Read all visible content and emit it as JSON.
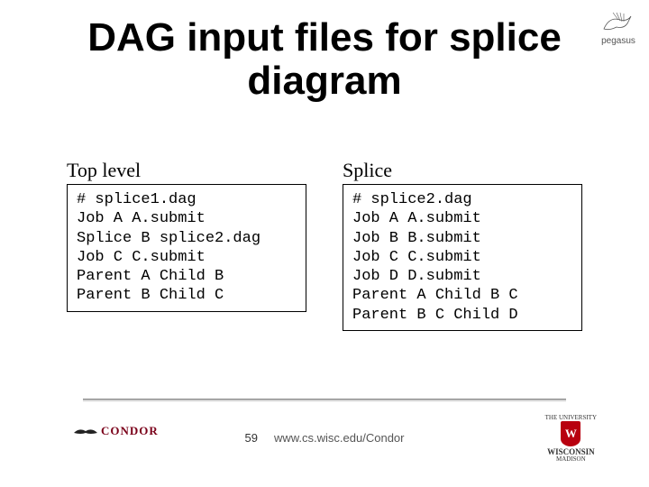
{
  "title": "DAG input files for splice diagram",
  "corner_label": "pegasus",
  "left": {
    "heading": "Top level",
    "code": "# splice1.dag\nJob A A.submit\nSplice B splice2.dag\nJob C C.submit\nParent A Child B\nParent B Child C"
  },
  "right": {
    "heading": "Splice",
    "code": "# splice2.dag\nJob A A.submit\nJob B B.submit\nJob C C.submit\nJob D D.submit\nParent A Child B C\nParent B C Child D"
  },
  "footer": {
    "page": "59",
    "url": "www.cs.wisc.edu/Condor",
    "condor": "CONDOR",
    "uw_top": "THE UNIVERSITY",
    "uw_mid": "WISCONSIN",
    "uw_bot": "MADISON"
  }
}
